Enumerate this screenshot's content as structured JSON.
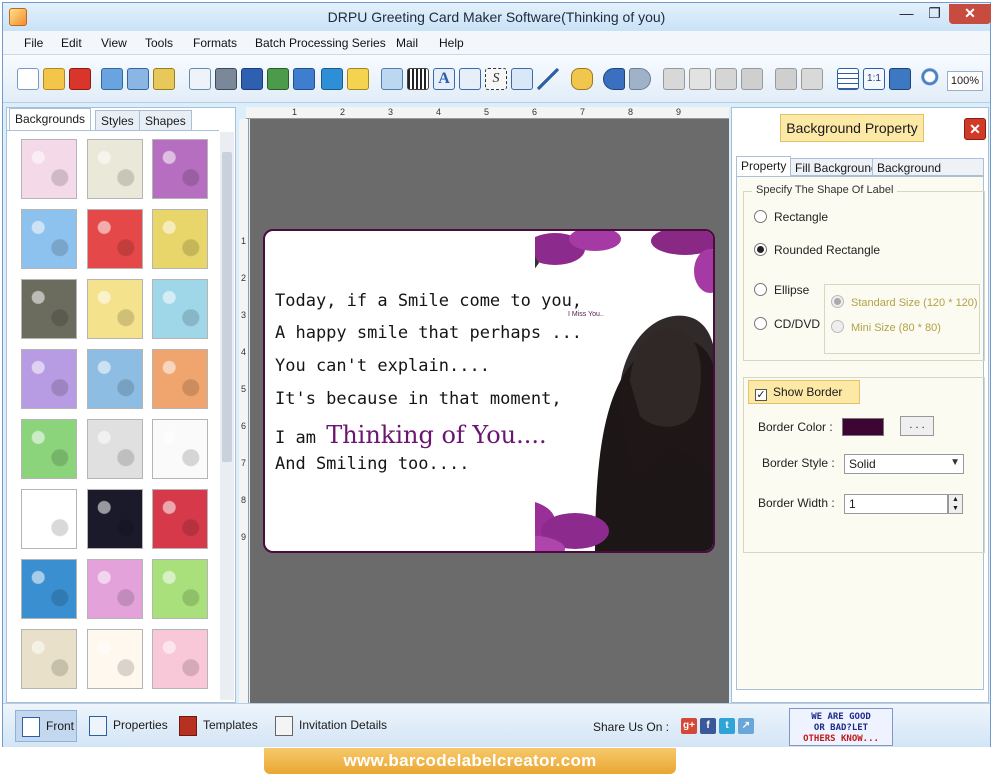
{
  "window": {
    "title": "DRPU Greeting Card Maker Software(Thinking of you)"
  },
  "menu": [
    "File",
    "Edit",
    "View",
    "Tools",
    "Formats",
    "Batch Processing Series",
    "Mail",
    "Help"
  ],
  "toolbar": {
    "zoom": "100%",
    "icons": [
      "new-icon",
      "open-icon",
      "close-doc-icon",
      "save-icon",
      "save-as-icon",
      "export-icon",
      "properties-icon",
      "print-icon",
      "print-preview-icon",
      "image-icon",
      "picture-icon",
      "pen-icon",
      "shape-icon",
      "watermark-icon",
      "barcode-icon",
      "text-icon",
      "signature-icon",
      "email-icon",
      "line-icon",
      "database-icon",
      "undo-icon",
      "redo-icon",
      "cut-icon",
      "copy-icon",
      "paste-icon",
      "delete-icon",
      "bring-front-icon",
      "send-back-icon",
      "grid-icon",
      "actual-size-icon",
      "fit-icon",
      "zoom-icon"
    ]
  },
  "left_panel": {
    "tabs": [
      "Backgrounds",
      "Styles",
      "Shapes"
    ],
    "active_tab": "Backgrounds",
    "thumbnails": [
      "#f4d9e8",
      "#eae8d8",
      "#b66fc0",
      "#8ec2ee",
      "#e54848",
      "#e9d66a",
      "#6b6b5e",
      "#f5e28c",
      "#9fd6e8",
      "#b79be3",
      "#8dbde3",
      "#f0a56e",
      "#8bd47c",
      "#e0e0e0",
      "#fafafa",
      "#ffffff",
      "#1a1a2a",
      "#d63a4a",
      "#3a8fd0",
      "#e3a3da",
      "#a9e07c",
      "#e8e0c8",
      "#fff8ee",
      "#f9c8d8"
    ]
  },
  "card": {
    "lines": [
      "Today, if a Smile come to you,",
      "A happy smile that perhaps ...",
      "You can't explain....",
      "It's because in that moment,"
    ],
    "prefix": "I am",
    "highlight": "Thinking of You....",
    "last_line": "And Smiling too....",
    "small_text": "I Miss You.."
  },
  "right_panel": {
    "title": "Background Property",
    "tabs": [
      "Property",
      "Fill Background",
      "Background Effects"
    ],
    "active_tab": "Property",
    "shape_legend": "Specify The Shape Of Label",
    "shapes": [
      {
        "label": "Rectangle",
        "selected": false
      },
      {
        "label": "Rounded Rectangle",
        "selected": true
      },
      {
        "label": "Ellipse",
        "selected": false
      },
      {
        "label": "CD/DVD",
        "selected": false
      }
    ],
    "sizes": [
      {
        "label": "Standard Size (120 * 120)",
        "selected": true,
        "disabled": true
      },
      {
        "label": "Mini Size (80 * 80)",
        "selected": false,
        "disabled": true
      }
    ],
    "show_border": {
      "label": "Show Border",
      "checked": true
    },
    "border_color": {
      "label": "Border Color :",
      "value": "#3e0534",
      "button": ". . ."
    },
    "border_style": {
      "label": "Border Style :",
      "value": "Solid"
    },
    "border_width": {
      "label": "Border Width :",
      "value": "1"
    }
  },
  "bottom_bar": {
    "buttons": [
      "Front",
      "Properties",
      "Templates",
      "Invitation Details"
    ],
    "share_label": "Share Us On :",
    "social": [
      "google-plus-icon",
      "facebook-icon",
      "twitter-icon",
      "share-icon"
    ],
    "feedback": [
      "WE ARE GOOD",
      "OR BAD?LET",
      "OTHERS KNOW..."
    ]
  },
  "footer": {
    "url": "www.barcodelabelcreator.com"
  }
}
